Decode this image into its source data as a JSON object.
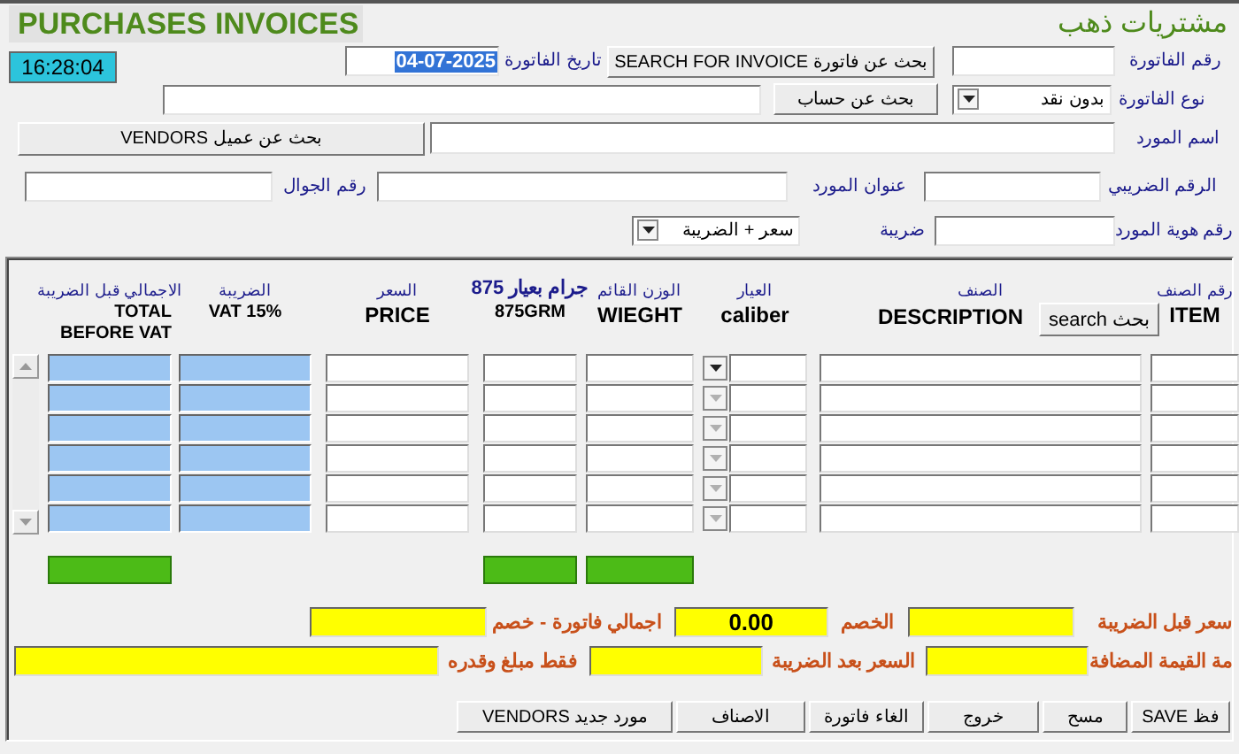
{
  "title": "PURCHASES INVOICES",
  "subtitle": "مشتريات ذهب",
  "clock": "16:28:04",
  "invoice_date": {
    "label": "تاريخ الفاتورة",
    "value": "04-07-2025"
  },
  "search_invoice_button": "SEARCH FOR INVOICE بحث عن فاتورة",
  "invoice_number": {
    "label": "رقم الفاتورة"
  },
  "search_account_button": "بحث عن حساب",
  "invoice_type": {
    "label": "نوع الفاتورة",
    "value": "بدون نقد"
  },
  "search_vendor_button": "VENDORS بحث عن عميل",
  "vendor_name": {
    "label": "اسم المورد"
  },
  "mobile": {
    "label": "رقم الجوال"
  },
  "vendor_address": {
    "label": "عنوان المورد"
  },
  "tax_number": {
    "label": "الرقم الضريبي"
  },
  "tax": {
    "label": "ضريبة",
    "value": "سعر + الضريبة"
  },
  "vendor_id": {
    "label": "رقم هوية المورد"
  },
  "table": {
    "search_button": "search بحث",
    "columns": [
      {
        "arabic": "رقم الصنف",
        "english": "ITEM",
        "kind": "text",
        "has_total": false
      },
      {
        "arabic": "الصنف",
        "english": "DESCRIPTION",
        "kind": "text",
        "has_total": false
      },
      {
        "arabic": "العيار",
        "english": "caliber",
        "kind": "dropdown",
        "has_total": false
      },
      {
        "arabic": "الوزن القائم",
        "english": "WIEGHT",
        "kind": "text",
        "has_total": true
      },
      {
        "arabic": "جرام بعيار 875",
        "english": "875GRM",
        "kind": "text",
        "has_total": true
      },
      {
        "arabic": "السعر",
        "english": "PRICE",
        "kind": "text",
        "has_total": false
      },
      {
        "arabic": "الضريبة",
        "english": "VAT 15%",
        "kind": "computed",
        "has_total": false
      },
      {
        "arabic": "الاجمالي قبل الضريبة",
        "english": "TOTAL BEFORE VAT",
        "kind": "computed",
        "has_total": true
      }
    ],
    "rows": [
      {
        "caliber_disabled": false
      },
      {
        "caliber_disabled": true
      },
      {
        "caliber_disabled": true
      },
      {
        "caliber_disabled": true
      },
      {
        "caliber_disabled": true
      },
      {
        "caliber_disabled": true
      }
    ]
  },
  "summary": {
    "net_total": {
      "label": "اجمالي فاتورة - خصم"
    },
    "discount": {
      "label": "الخصم",
      "value": "0.00"
    },
    "price_before_tax": {
      "label": "سعر قبل الضريبة"
    },
    "amount_in_words": {
      "label": "فقط مبلغ وقدره"
    },
    "price_after_tax": {
      "label": "السعر بعد الضريبة"
    },
    "vat_value": {
      "label": "مة القيمة المضافة"
    }
  },
  "buttons": [
    "SAVE فظ",
    "مسح",
    "خروج",
    "الغاء فاتورة",
    "الاصناف",
    "VENDORS مورد جديد"
  ]
}
